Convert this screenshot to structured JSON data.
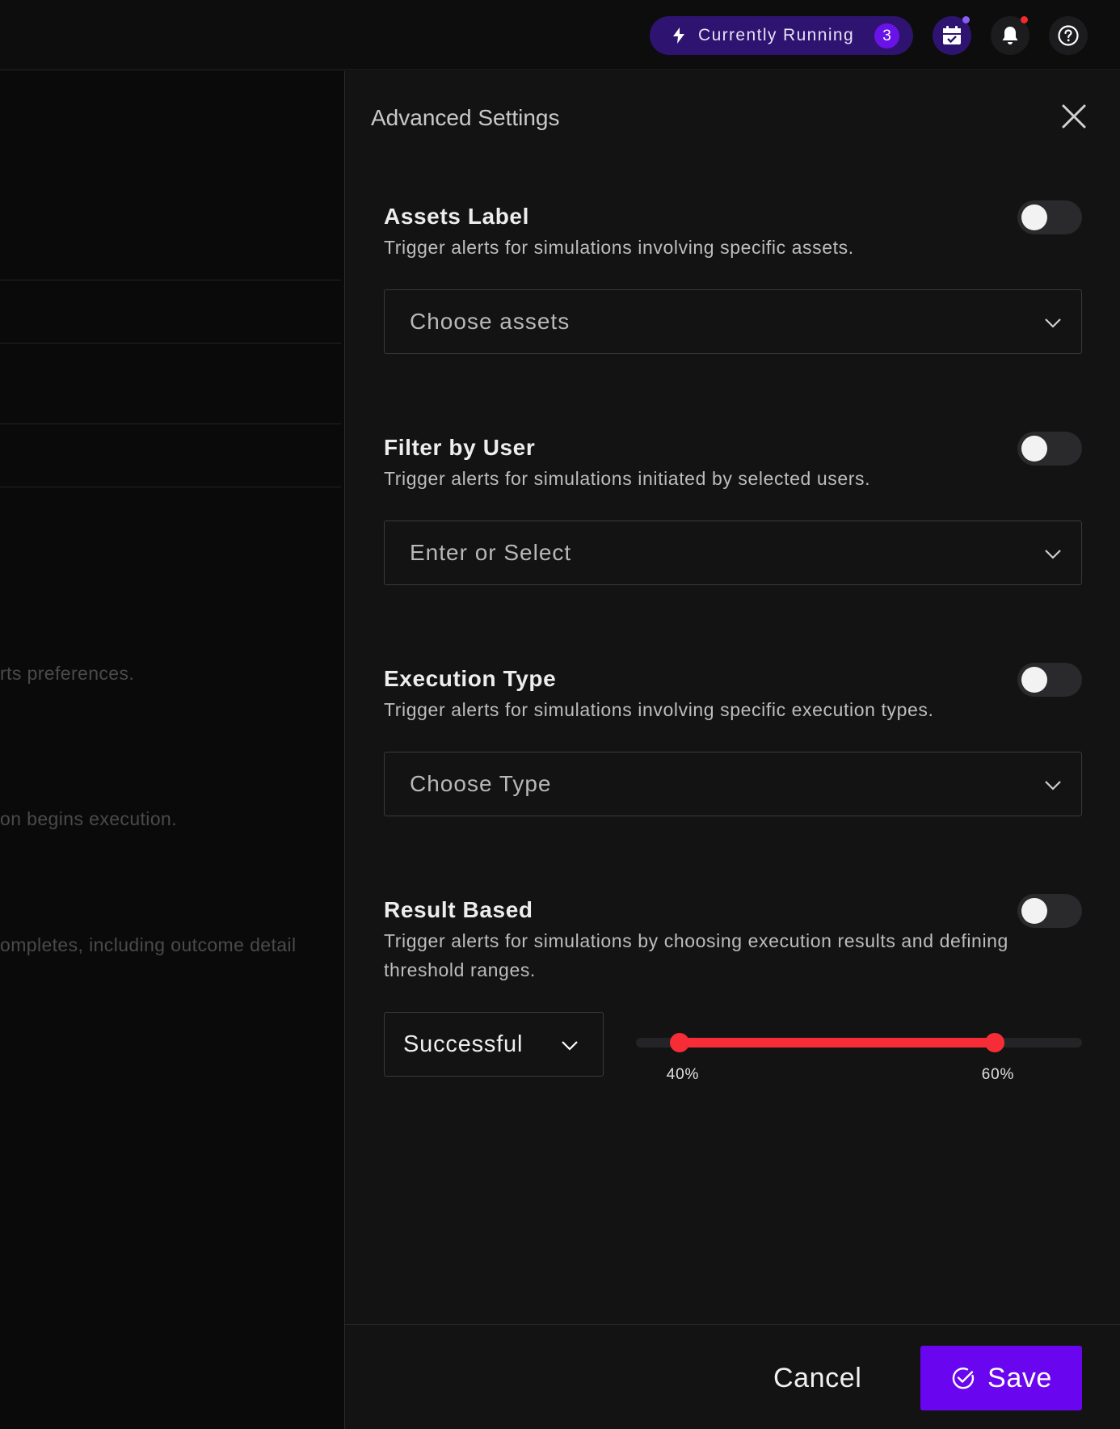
{
  "topbar": {
    "running_label": "Currently Running",
    "running_count": "3",
    "icons": [
      "lightning-icon",
      "calendar-check-icon",
      "bell-icon",
      "help-icon"
    ],
    "accent": "#6a13e8",
    "calendar_dot_color": "#8b5cf6",
    "bell_dot_color": "#ef2b2b"
  },
  "background": {
    "texts": [
      "rts preferences.",
      "on begins execution.",
      "ompletes, including outcome detail"
    ]
  },
  "panel": {
    "title": "Advanced Settings",
    "sections": [
      {
        "title": "Assets Label",
        "description": "Trigger alerts for simulations involving specific assets.",
        "toggle_on": false,
        "placeholder": "Choose assets"
      },
      {
        "title": "Filter by User",
        "description": "Trigger alerts for simulations initiated by selected users.",
        "toggle_on": false,
        "placeholder": "Enter or Select"
      },
      {
        "title": "Execution Type",
        "description": "Trigger alerts for simulations involving specific execution types.",
        "toggle_on": false,
        "placeholder": "Choose Type"
      },
      {
        "title": "Result Based",
        "description": "Trigger alerts for simulations by choosing execution results and defining threshold ranges.",
        "toggle_on": false
      }
    ],
    "result": {
      "selected": "Successful",
      "range_min": 40,
      "range_max": 60,
      "range_min_label": "40%",
      "range_max_label": "60%",
      "slider_color": "#f62d36"
    },
    "footer": {
      "cancel_label": "Cancel",
      "save_label": "Save",
      "save_color": "#6a06ef"
    }
  }
}
